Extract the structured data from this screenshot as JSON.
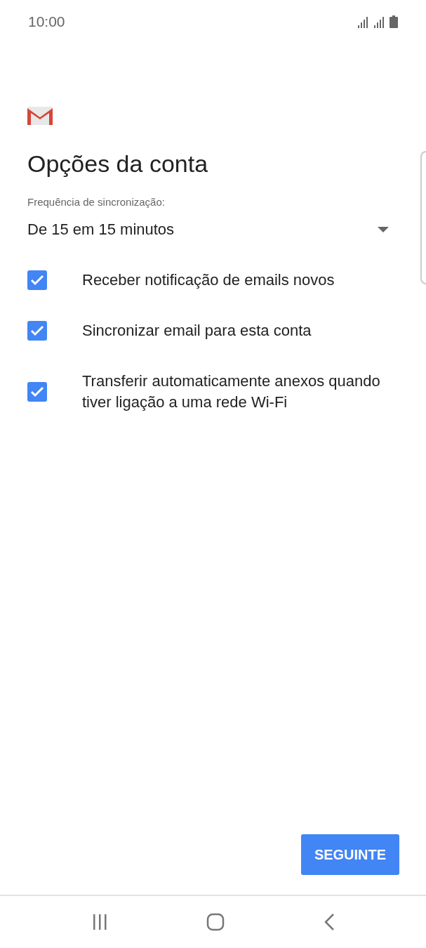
{
  "status_bar": {
    "time": "10:00"
  },
  "title": "Opções da conta",
  "sync_frequency": {
    "label": "Frequência de sincronização:",
    "value": "De 15 em 15 minutos"
  },
  "options": [
    {
      "label": "Receber notificação de emails novos",
      "checked": true
    },
    {
      "label": "Sincronizar email para esta conta",
      "checked": true
    },
    {
      "label": "Transferir automaticamente anexos quando tiver ligação a uma rede Wi-Fi",
      "checked": true
    }
  ],
  "next_button": "SEGUINTE"
}
